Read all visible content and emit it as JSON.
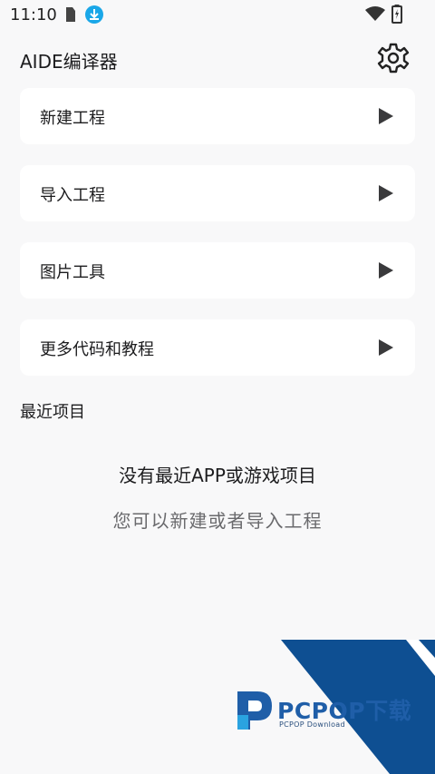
{
  "status_bar": {
    "time": "11:10"
  },
  "app_bar": {
    "title": "AIDE编译器"
  },
  "menu": {
    "items": [
      {
        "label": "新建工程"
      },
      {
        "label": "导入工程"
      },
      {
        "label": "图片工具"
      },
      {
        "label": "更多代码和教程"
      }
    ]
  },
  "recent": {
    "section_title": "最近项目",
    "empty_title": "没有最近APP或游戏项目",
    "empty_subtitle": "您可以新建或者导入工程"
  },
  "watermark": {
    "brand": "PCPOP下载",
    "sub": "PCPOP Download"
  },
  "colors": {
    "background": "#f8f8f9",
    "card": "#ffffff",
    "download_badge": "#1aa7e8",
    "watermark_blue": "#0e4f92"
  },
  "icons": [
    "sim-card-icon",
    "download-icon",
    "wifi-icon",
    "battery-charging-icon",
    "settings-gear-icon",
    "play-arrow-icon"
  ]
}
